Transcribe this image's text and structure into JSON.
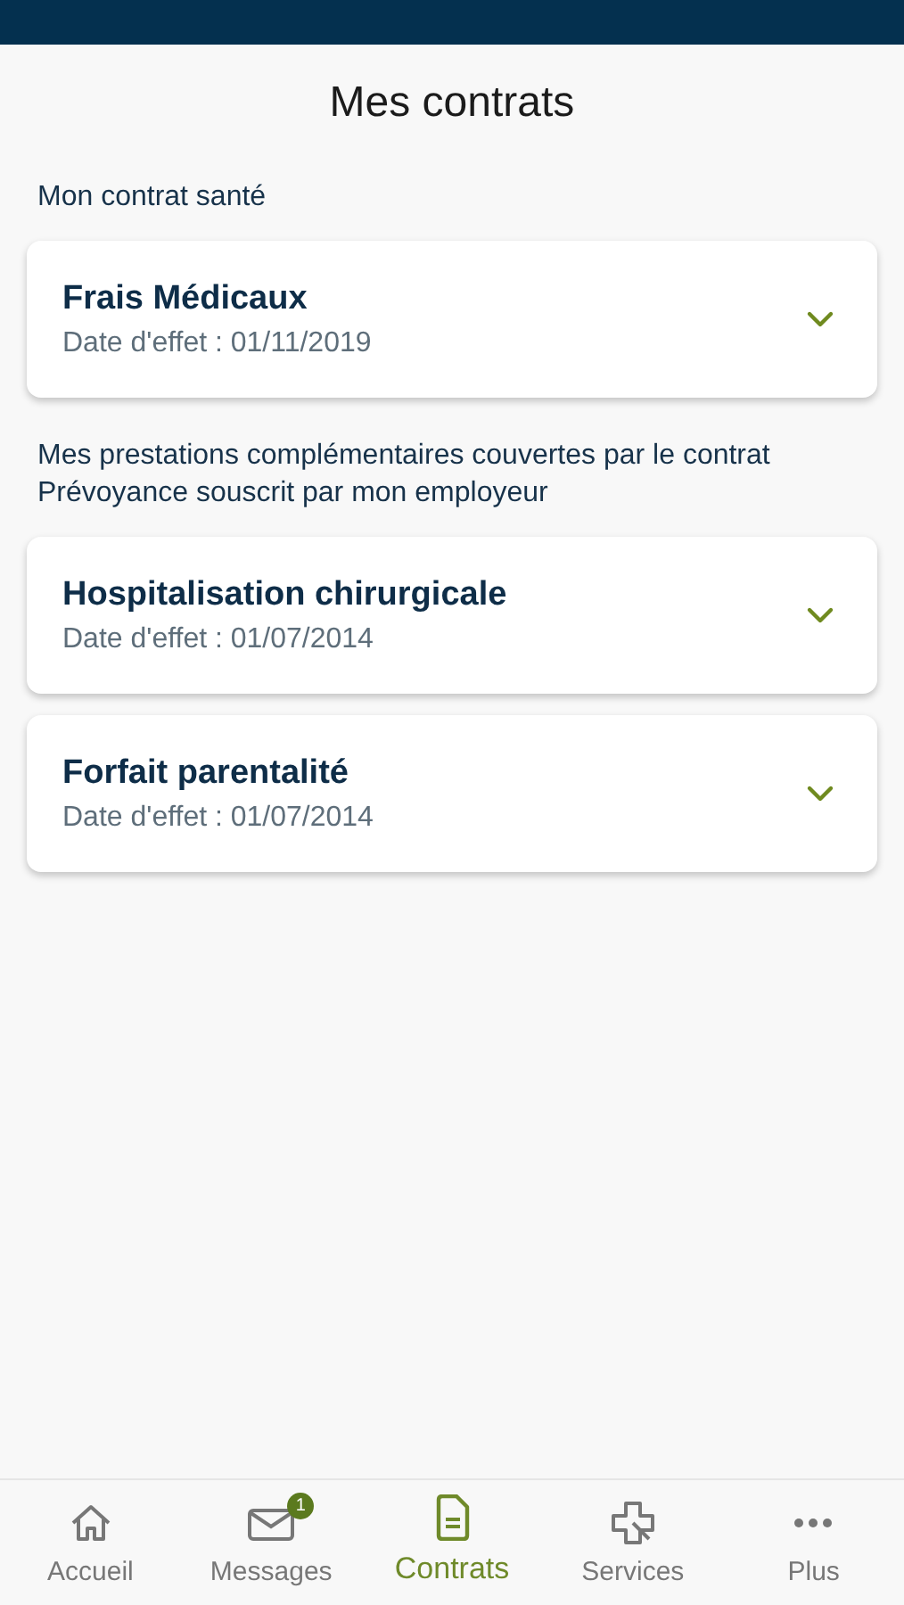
{
  "header": {
    "title": "Mes contrats"
  },
  "sections": [
    {
      "heading": "Mon contrat santé",
      "contracts": [
        {
          "name": "Frais Médicaux",
          "date": "Date d'effet : 01/11/2019",
          "expanded": false
        }
      ]
    },
    {
      "heading": "Mes prestations complémentaires couvertes par le contrat Prévoyance souscrit par mon employeur",
      "contracts": [
        {
          "name": "Hospitalisation chirurgicale",
          "date": "Date d'effet : 01/07/2014",
          "expanded": false
        },
        {
          "name": "Forfait parentalité",
          "date": "Date d'effet : 01/07/2014",
          "expanded": false
        }
      ]
    }
  ],
  "tab_bar": [
    {
      "kind": "home",
      "label": "Accueil",
      "selected": false
    },
    {
      "kind": "mail",
      "label": "Messages",
      "selected": false,
      "badge": "1"
    },
    {
      "kind": "document",
      "label": "Contrats",
      "selected": true
    },
    {
      "kind": "cross",
      "label": "Services",
      "selected": false
    },
    {
      "kind": "more",
      "label": "Plus",
      "selected": false
    }
  ]
}
